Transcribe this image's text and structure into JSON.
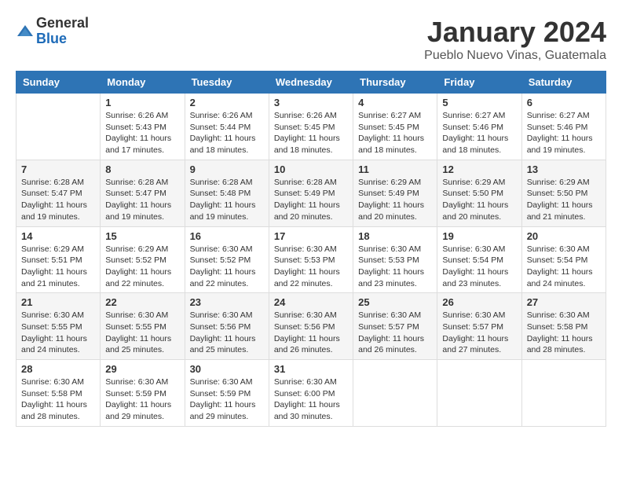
{
  "logo": {
    "general": "General",
    "blue": "Blue"
  },
  "title": "January 2024",
  "subtitle": "Pueblo Nuevo Vinas, Guatemala",
  "headers": [
    "Sunday",
    "Monday",
    "Tuesday",
    "Wednesday",
    "Thursday",
    "Friday",
    "Saturday"
  ],
  "weeks": [
    [
      {
        "day": "",
        "sunrise": "",
        "sunset": "",
        "daylight": ""
      },
      {
        "day": "1",
        "sunrise": "Sunrise: 6:26 AM",
        "sunset": "Sunset: 5:43 PM",
        "daylight": "Daylight: 11 hours and 17 minutes."
      },
      {
        "day": "2",
        "sunrise": "Sunrise: 6:26 AM",
        "sunset": "Sunset: 5:44 PM",
        "daylight": "Daylight: 11 hours and 18 minutes."
      },
      {
        "day": "3",
        "sunrise": "Sunrise: 6:26 AM",
        "sunset": "Sunset: 5:45 PM",
        "daylight": "Daylight: 11 hours and 18 minutes."
      },
      {
        "day": "4",
        "sunrise": "Sunrise: 6:27 AM",
        "sunset": "Sunset: 5:45 PM",
        "daylight": "Daylight: 11 hours and 18 minutes."
      },
      {
        "day": "5",
        "sunrise": "Sunrise: 6:27 AM",
        "sunset": "Sunset: 5:46 PM",
        "daylight": "Daylight: 11 hours and 18 minutes."
      },
      {
        "day": "6",
        "sunrise": "Sunrise: 6:27 AM",
        "sunset": "Sunset: 5:46 PM",
        "daylight": "Daylight: 11 hours and 19 minutes."
      }
    ],
    [
      {
        "day": "7",
        "sunrise": "Sunrise: 6:28 AM",
        "sunset": "Sunset: 5:47 PM",
        "daylight": "Daylight: 11 hours and 19 minutes."
      },
      {
        "day": "8",
        "sunrise": "Sunrise: 6:28 AM",
        "sunset": "Sunset: 5:47 PM",
        "daylight": "Daylight: 11 hours and 19 minutes."
      },
      {
        "day": "9",
        "sunrise": "Sunrise: 6:28 AM",
        "sunset": "Sunset: 5:48 PM",
        "daylight": "Daylight: 11 hours and 19 minutes."
      },
      {
        "day": "10",
        "sunrise": "Sunrise: 6:28 AM",
        "sunset": "Sunset: 5:49 PM",
        "daylight": "Daylight: 11 hours and 20 minutes."
      },
      {
        "day": "11",
        "sunrise": "Sunrise: 6:29 AM",
        "sunset": "Sunset: 5:49 PM",
        "daylight": "Daylight: 11 hours and 20 minutes."
      },
      {
        "day": "12",
        "sunrise": "Sunrise: 6:29 AM",
        "sunset": "Sunset: 5:50 PM",
        "daylight": "Daylight: 11 hours and 20 minutes."
      },
      {
        "day": "13",
        "sunrise": "Sunrise: 6:29 AM",
        "sunset": "Sunset: 5:50 PM",
        "daylight": "Daylight: 11 hours and 21 minutes."
      }
    ],
    [
      {
        "day": "14",
        "sunrise": "Sunrise: 6:29 AM",
        "sunset": "Sunset: 5:51 PM",
        "daylight": "Daylight: 11 hours and 21 minutes."
      },
      {
        "day": "15",
        "sunrise": "Sunrise: 6:29 AM",
        "sunset": "Sunset: 5:52 PM",
        "daylight": "Daylight: 11 hours and 22 minutes."
      },
      {
        "day": "16",
        "sunrise": "Sunrise: 6:30 AM",
        "sunset": "Sunset: 5:52 PM",
        "daylight": "Daylight: 11 hours and 22 minutes."
      },
      {
        "day": "17",
        "sunrise": "Sunrise: 6:30 AM",
        "sunset": "Sunset: 5:53 PM",
        "daylight": "Daylight: 11 hours and 22 minutes."
      },
      {
        "day": "18",
        "sunrise": "Sunrise: 6:30 AM",
        "sunset": "Sunset: 5:53 PM",
        "daylight": "Daylight: 11 hours and 23 minutes."
      },
      {
        "day": "19",
        "sunrise": "Sunrise: 6:30 AM",
        "sunset": "Sunset: 5:54 PM",
        "daylight": "Daylight: 11 hours and 23 minutes."
      },
      {
        "day": "20",
        "sunrise": "Sunrise: 6:30 AM",
        "sunset": "Sunset: 5:54 PM",
        "daylight": "Daylight: 11 hours and 24 minutes."
      }
    ],
    [
      {
        "day": "21",
        "sunrise": "Sunrise: 6:30 AM",
        "sunset": "Sunset: 5:55 PM",
        "daylight": "Daylight: 11 hours and 24 minutes."
      },
      {
        "day": "22",
        "sunrise": "Sunrise: 6:30 AM",
        "sunset": "Sunset: 5:55 PM",
        "daylight": "Daylight: 11 hours and 25 minutes."
      },
      {
        "day": "23",
        "sunrise": "Sunrise: 6:30 AM",
        "sunset": "Sunset: 5:56 PM",
        "daylight": "Daylight: 11 hours and 25 minutes."
      },
      {
        "day": "24",
        "sunrise": "Sunrise: 6:30 AM",
        "sunset": "Sunset: 5:56 PM",
        "daylight": "Daylight: 11 hours and 26 minutes."
      },
      {
        "day": "25",
        "sunrise": "Sunrise: 6:30 AM",
        "sunset": "Sunset: 5:57 PM",
        "daylight": "Daylight: 11 hours and 26 minutes."
      },
      {
        "day": "26",
        "sunrise": "Sunrise: 6:30 AM",
        "sunset": "Sunset: 5:57 PM",
        "daylight": "Daylight: 11 hours and 27 minutes."
      },
      {
        "day": "27",
        "sunrise": "Sunrise: 6:30 AM",
        "sunset": "Sunset: 5:58 PM",
        "daylight": "Daylight: 11 hours and 28 minutes."
      }
    ],
    [
      {
        "day": "28",
        "sunrise": "Sunrise: 6:30 AM",
        "sunset": "Sunset: 5:58 PM",
        "daylight": "Daylight: 11 hours and 28 minutes."
      },
      {
        "day": "29",
        "sunrise": "Sunrise: 6:30 AM",
        "sunset": "Sunset: 5:59 PM",
        "daylight": "Daylight: 11 hours and 29 minutes."
      },
      {
        "day": "30",
        "sunrise": "Sunrise: 6:30 AM",
        "sunset": "Sunset: 5:59 PM",
        "daylight": "Daylight: 11 hours and 29 minutes."
      },
      {
        "day": "31",
        "sunrise": "Sunrise: 6:30 AM",
        "sunset": "Sunset: 6:00 PM",
        "daylight": "Daylight: 11 hours and 30 minutes."
      },
      {
        "day": "",
        "sunrise": "",
        "sunset": "",
        "daylight": ""
      },
      {
        "day": "",
        "sunrise": "",
        "sunset": "",
        "daylight": ""
      },
      {
        "day": "",
        "sunrise": "",
        "sunset": "",
        "daylight": ""
      }
    ]
  ]
}
